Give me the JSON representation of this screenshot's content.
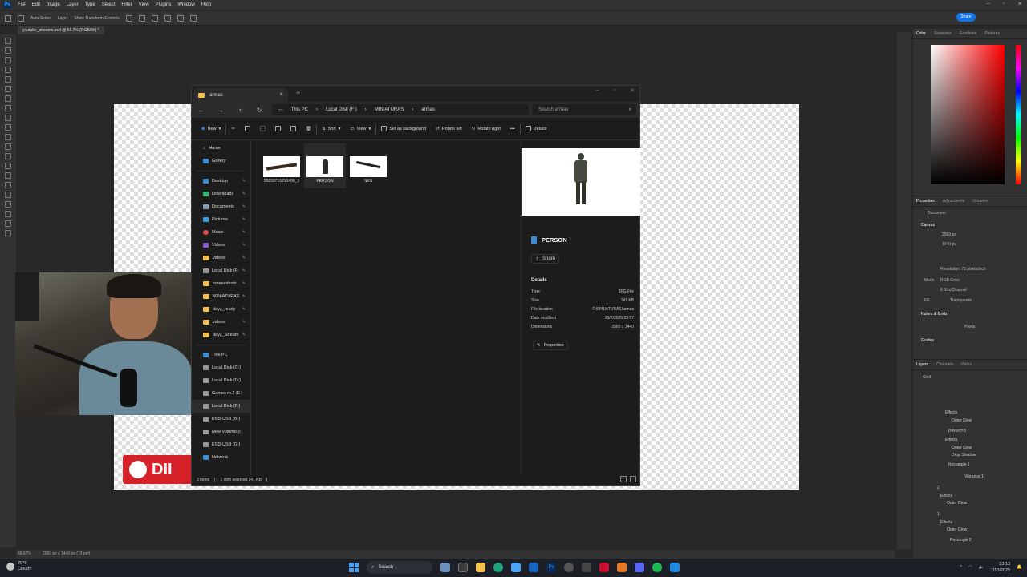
{
  "photoshop": {
    "menus": [
      "File",
      "Edit",
      "Image",
      "Layer",
      "Type",
      "Select",
      "Filter",
      "View",
      "Plugins",
      "Window",
      "Help"
    ],
    "options": {
      "auto_select": "Auto-Select",
      "layer": "Layer",
      "transform_controls": "Show Transform Controls"
    },
    "share": "Share",
    "doc_tab": "youtube_streams.psd @ 66.7% (RGB/8#) *",
    "status_zoom": "66.67%",
    "status_doc": "2560 px x 1440 px (72 ppi)",
    "color_tabs": [
      "Color",
      "Swatches",
      "Gradients",
      "Patterns"
    ],
    "props_tabs": [
      "Properties",
      "Adjustments",
      "Libraries"
    ],
    "props": {
      "document": "Document",
      "canvas": "Canvas",
      "w": "2560 px",
      "h": "1440 px",
      "resolution": "Resolution: 72 pixels/inch",
      "mode_label": "Mode",
      "mode": "RGB Color",
      "bits": "8 Bits/Channel",
      "fill_label": "Fill",
      "fill": "Transparent",
      "rulers": "Rulers & Grids",
      "units": "Pixels",
      "guides": "Guides"
    },
    "layer_tabs": [
      "Layers",
      "Channels",
      "Paths"
    ],
    "layer_kind": "Kind",
    "layers": [
      "Effects",
      "Outer Glow",
      "DIRECTO",
      "Effects",
      "Outer Glow",
      "Drop Shadow",
      "Rectangle 1",
      "Vibrance 1",
      "2",
      "Effects",
      "Outer Glow",
      "1",
      "Effects",
      "Outer Glow",
      "Rectangle 2"
    ],
    "banner_text": "DII"
  },
  "explorer": {
    "tab_title": "armas",
    "breadcrumb": [
      "This PC",
      "Local Disk (F:)",
      "MINIATURAS",
      "armas"
    ],
    "search_placeholder": "Search armas",
    "commands": {
      "new": "New",
      "sort": "Sort",
      "view": "View",
      "set_bg": "Set as background",
      "rotate_left": "Rotate left",
      "rotate_right": "Rotate right",
      "more": "•••",
      "details": "Details"
    },
    "nav": {
      "home": "Home",
      "gallery": "Gallery",
      "desktop": "Desktop",
      "downloads": "Downloads",
      "documents": "Documents",
      "pictures": "Pictures",
      "music": "Music",
      "videos": "Videos",
      "videos2": "videos",
      "local_f": "Local Disk (F:",
      "screenshots": "screenshots",
      "miniaturas": "MINIATURAS",
      "dayz_ready": "dayz_ready",
      "videos3": "videos",
      "dayz_streams": "dayz_Stream",
      "this_pc": "This PC",
      "c": "Local Disk (C:)",
      "d": "Local Disk (D:)",
      "games": "Games m.2 (E:",
      "f2": "Local Disk (F:)",
      "esd1": "ESD-USB (G:)",
      "newvol": "New Volume (I",
      "esd2": "ESD-USB (G:)",
      "network": "Network"
    },
    "files": [
      {
        "name": "20250715210400_1"
      },
      {
        "name": "PERSON"
      },
      {
        "name": "SKS"
      }
    ],
    "preview": {
      "name": "PERSON",
      "share": "Share",
      "details": "Details",
      "rows": [
        {
          "k": "Type",
          "v": "JPG File"
        },
        {
          "k": "Size",
          "v": "141 KB"
        },
        {
          "k": "File location",
          "v": "F:\\MINIATURAS\\armas"
        },
        {
          "k": "Date modified",
          "v": "25/7/2025 23:57"
        },
        {
          "k": "Dimensions",
          "v": "2560 x 1440"
        }
      ],
      "properties": "Properties"
    },
    "status": {
      "items": "3 items",
      "selected": "1 item selected  141 KB"
    }
  },
  "taskbar": {
    "temp": "70°F",
    "weather": "Cloudy",
    "search": "Search",
    "time": "23:13",
    "date": "7/10/2025"
  }
}
